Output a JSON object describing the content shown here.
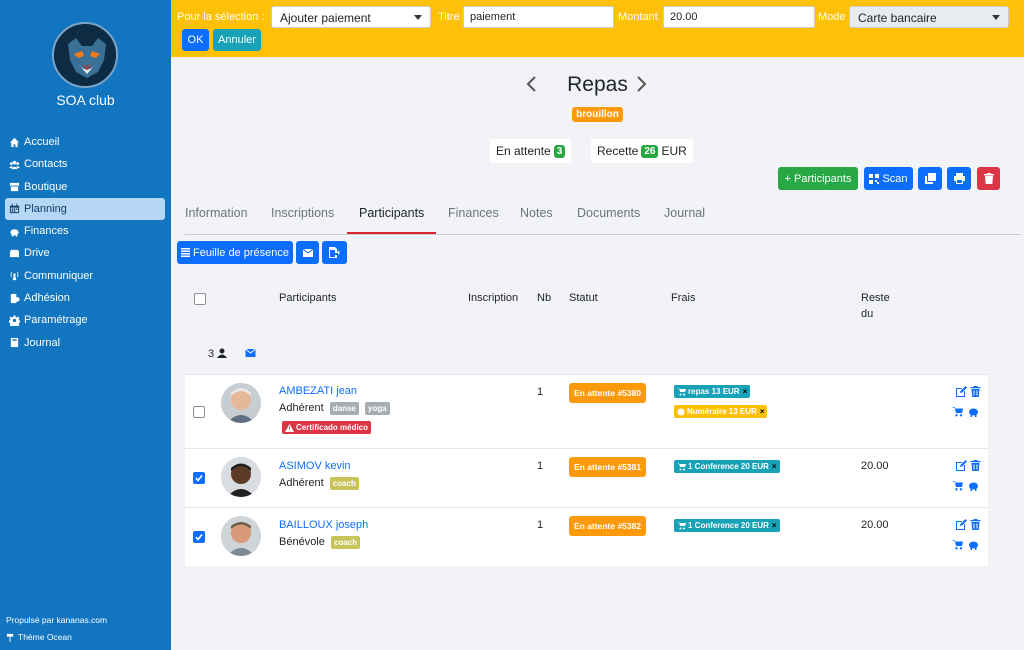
{
  "sidebar": {
    "club_name": "SOA club",
    "items": [
      {
        "label": "Accueil",
        "icon": "home-icon"
      },
      {
        "label": "Contacts",
        "icon": "users-icon"
      },
      {
        "label": "Boutique",
        "icon": "store-icon"
      },
      {
        "label": "Planning",
        "icon": "calendar-icon",
        "active": true
      },
      {
        "label": "Finances",
        "icon": "piggy-icon"
      },
      {
        "label": "Drive",
        "icon": "drive-icon"
      },
      {
        "label": "Communiquer",
        "icon": "broadcast-icon"
      },
      {
        "label": "Adhésion",
        "icon": "membership-icon"
      },
      {
        "label": "Paramétrage",
        "icon": "gear-icon"
      },
      {
        "label": "Journal",
        "icon": "book-icon"
      }
    ],
    "footer_powered": "Propulsé par kananas.com",
    "footer_theme": "Thème Ocean"
  },
  "topbar": {
    "selection_label": "Pour la sélection :",
    "action_value": "Ajouter paiement",
    "title_label": "Titre",
    "title_value": "paiement",
    "amount_label": "Montant",
    "amount_value": "20.00",
    "mode_label": "Mode",
    "mode_value": "Carte bancaire",
    "ok_label": "OK",
    "cancel_label": "Annuler"
  },
  "event": {
    "title": "Repas",
    "status_badge": "brouillon",
    "waiting_label": "En attente",
    "waiting_count": "3",
    "revenue_label": "Recette",
    "revenue_value": "26",
    "revenue_currency": "EUR"
  },
  "actions": {
    "participants_label": "+ Participants",
    "scan_label": "Scan"
  },
  "tabs": [
    "Information",
    "Inscriptions",
    "Participants",
    "Finances",
    "Notes",
    "Documents",
    "Journal"
  ],
  "subactions": {
    "attendance_label": "Feuille de présence"
  },
  "table": {
    "headers": {
      "participants": "Participants",
      "inscription": "Inscription",
      "nb": "Nb",
      "statut": "Statut",
      "frais": "Frais",
      "reste_1": "Reste",
      "reste_2": "du"
    },
    "summary_count": "3",
    "rows": [
      {
        "name": "AMBEZATI jean",
        "role": "Adhérent",
        "tags": [
          "danse",
          "yoga"
        ],
        "alert": "Certificado médico",
        "nb": "1",
        "status": "En attente #5380",
        "fees": [
          "repas 13 EUR",
          "Numéraire 13 EUR"
        ],
        "reste": "",
        "checked": false
      },
      {
        "name": "ASIMOV kevin",
        "role": "Adhérent",
        "tags": [
          "coach"
        ],
        "nb": "1",
        "status": "En attente #5381",
        "fees": [
          "1 Conference 20 EUR"
        ],
        "reste": "20.00",
        "checked": true
      },
      {
        "name": "BAILLOUX joseph",
        "role": "Bénévole",
        "tags": [
          "coach"
        ],
        "nb": "1",
        "status": "En attente #5382",
        "fees": [
          "1 Conference 20 EUR"
        ],
        "reste": "20.00",
        "checked": true
      }
    ]
  },
  "colors": {
    "sidebar": "#1275c0",
    "topbar": "#fec107",
    "primary": "#0d6efd",
    "success": "#28a745",
    "danger": "#dc3545",
    "warning": "#fd9a0b",
    "teal": "#17a2b8"
  }
}
